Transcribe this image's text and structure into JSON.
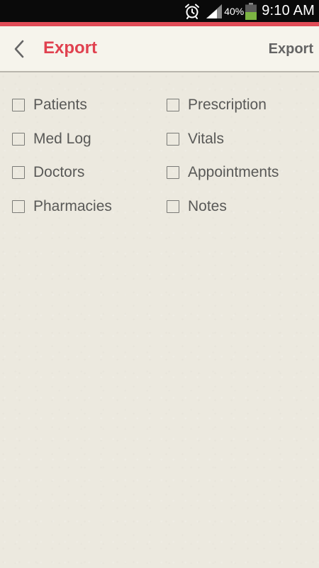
{
  "status_bar": {
    "battery_percent": "40%",
    "time": "9:10 AM",
    "icons": [
      "alarm-icon",
      "signal-icon",
      "battery-icon"
    ]
  },
  "colors": {
    "accent": "#e14c57",
    "title": "#e0414f",
    "background": "#ece9df"
  },
  "action_bar": {
    "back_icon": "chevron-left-icon",
    "title": "Export",
    "action_label": "Export"
  },
  "options": [
    {
      "label": "Patients",
      "checked": false
    },
    {
      "label": "Prescription",
      "checked": false
    },
    {
      "label": "Med Log",
      "checked": false
    },
    {
      "label": "Vitals",
      "checked": false
    },
    {
      "label": "Doctors",
      "checked": false
    },
    {
      "label": "Appointments",
      "checked": false
    },
    {
      "label": "Pharmacies",
      "checked": false
    },
    {
      "label": "Notes",
      "checked": false
    }
  ]
}
